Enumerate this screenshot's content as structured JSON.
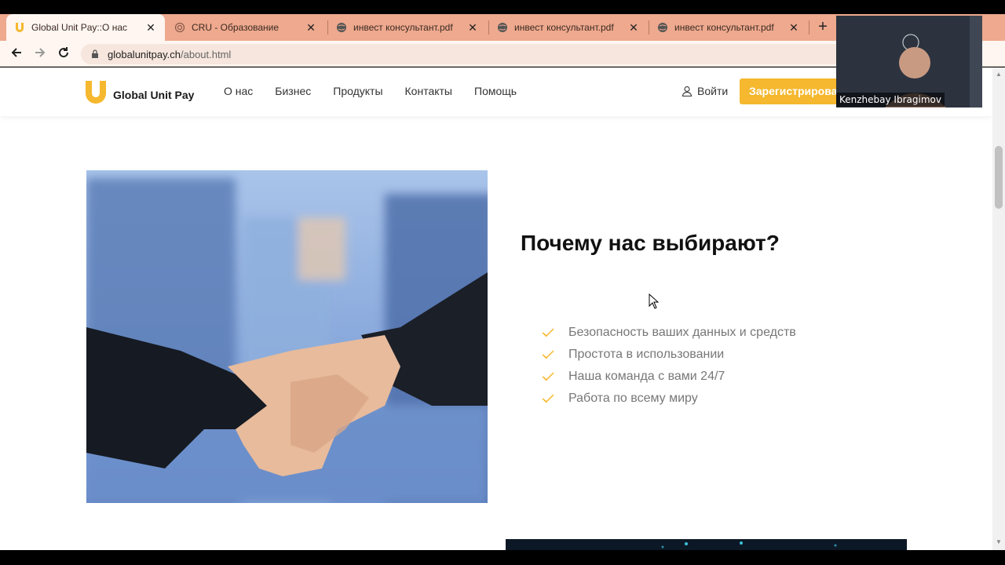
{
  "browser": {
    "tabs": [
      {
        "title": "Global Unit Pay::О нас",
        "active": true,
        "favicon": "u-logo-icon"
      },
      {
        "title": "CRU - Образование",
        "active": false,
        "favicon": "spiral-icon"
      },
      {
        "title": "инвест консультант.pdf",
        "active": false,
        "favicon": "globe-icon"
      },
      {
        "title": "инвест консультант.pdf",
        "active": false,
        "favicon": "globe-icon"
      },
      {
        "title": "инвест консультант.pdf",
        "active": false,
        "favicon": "globe-icon"
      }
    ],
    "url_host": "globalunitpay.ch",
    "url_path": "/about.html"
  },
  "site": {
    "logo_text": "Global Unit Pay",
    "nav": [
      "О нас",
      "Бизнес",
      "Продукты",
      "Контакты",
      "Помощь"
    ],
    "login_label": "Войти",
    "register_label": "Зарегистрироваться"
  },
  "section": {
    "title": "Почему нас выбирают?",
    "features": [
      "Безопасность ваших данных и средств",
      "Простота в использовании",
      "Наша команда с вами 24/7",
      "Работа по всему миру"
    ]
  },
  "video_call": {
    "participant_name": "Kenzhebay Ibragimov"
  },
  "colors": {
    "accent": "#f5b82e",
    "tabstrip": "#eea98e"
  }
}
